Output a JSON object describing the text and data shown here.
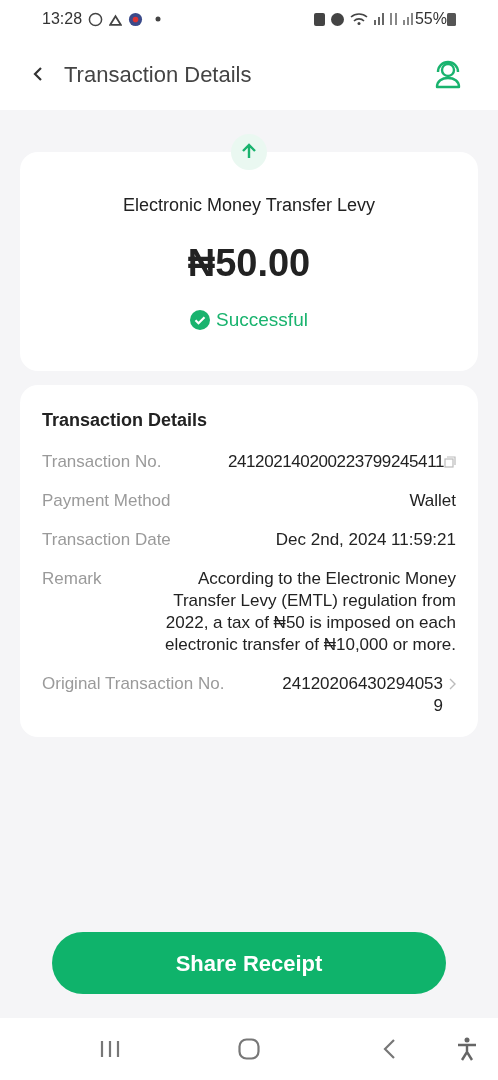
{
  "status_bar": {
    "time": "13:28",
    "battery": "55%"
  },
  "header": {
    "title": "Transaction Details"
  },
  "summary": {
    "title": "Electronic Money Transfer Levy",
    "amount": "₦50.00",
    "status": "Successful"
  },
  "details": {
    "title": "Transaction Details",
    "rows": [
      {
        "label": "Transaction No.",
        "value": "241202140200223799245411",
        "kind": "copy"
      },
      {
        "label": "Payment Method",
        "value": "Wallet",
        "kind": "plain"
      },
      {
        "label": "Transaction Date",
        "value": "Dec 2nd, 2024 11:59:21",
        "kind": "plain"
      },
      {
        "label": "Remark",
        "value": "According to the Electronic Money Transfer Levy (EMTL) regulation from 2022, a tax of ₦50 is imposed on each electronic transfer of ₦10,000 or more.",
        "kind": "wrap"
      },
      {
        "label": "Original Transaction No.",
        "value": "241202064302940539",
        "kind": "link"
      }
    ]
  },
  "share_button": "Share Receipt"
}
